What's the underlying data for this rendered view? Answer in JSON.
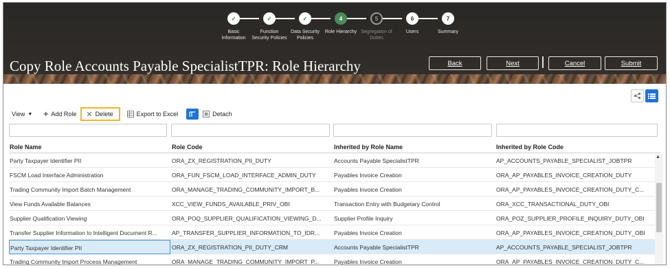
{
  "title": "Copy Role Accounts Payable SpecialistTPR: Role Hierarchy",
  "train": {
    "steps": [
      {
        "num": "✓",
        "label": "Basic\nInformation",
        "state": "done"
      },
      {
        "num": "✓",
        "label": "Function\nSecurity Policies",
        "state": "done"
      },
      {
        "num": "✓",
        "label": "Data Security\nPolicies",
        "state": "done"
      },
      {
        "num": "4",
        "label": "Role Hierarchy",
        "state": "current"
      },
      {
        "num": "5",
        "label": "Segregation of\nDuties",
        "state": "disabled"
      },
      {
        "num": "6",
        "label": "Users",
        "state": "future"
      },
      {
        "num": "7",
        "label": "Summary",
        "state": "future"
      }
    ]
  },
  "buttons": {
    "back": "Back",
    "next": "Next",
    "cancel": "Cancel",
    "submit": "Submit"
  },
  "toolbar": {
    "view": "View",
    "add_role": "Add Role",
    "delete": "Delete",
    "export": "Export to Excel",
    "detach": "Detach"
  },
  "table": {
    "columns": [
      "Role Name",
      "Role Code",
      "Inherited by Role Name",
      "Inherited by Role Code"
    ],
    "rows": [
      [
        "Party Taxpayer Identifier PII",
        "ORA_ZX_REGISTRATION_PII_DUTY",
        "Accounts Payable SpecialistTPR",
        "AP_ACCOUNTS_PAYABLE_SPECIALIST_JOBTPR"
      ],
      [
        "FSCM Load Interface Administration",
        "ORA_FUN_FSCM_LOAD_INTERFACE_ADMIN_DUTY",
        "Payables Invoice Creation",
        "ORA_AP_PAYABLES_INVOICE_CREATION_DUTY"
      ],
      [
        "Trading Community Import Batch Management",
        "ORA_MANAGE_TRADING_COMMUNITY_IMPORT_B...",
        "Payables Invoice Creation",
        "ORA_AP_PAYABLES_INVOICE_CREATION_DUTY_C..."
      ],
      [
        "View Funds Available Balances",
        "XCC_VIEW_FUNDS_AVAILABLE_PRIV_OBI",
        "Transaction Entry with Budgetary Control",
        "ORA_XCC_TRANSACTIONAL_DUTY_OBI"
      ],
      [
        "Supplier Qualification Viewing",
        "ORA_POQ_SUPPLIER_QUALIFICATION_VIEWING_D...",
        "Supplier Profile Inquiry",
        "ORA_POZ_SUPPLIER_PROFILE_INQUIRY_DUTY_OBI"
      ],
      [
        "Transfer Supplier Information to Intelligent Document R...",
        "AP_TRANSFER_SUPPLIER_INFORMATION_TO_IDR...",
        "Payables Invoice Creation",
        "ORA_AP_PAYABLES_INVOICE_CREATION_DUTY_OBI"
      ],
      [
        "Party Taxpayer Identifier PII",
        "ORA_ZX_REGISTRATION_PII_DUTY_CRM",
        "Accounts Payable SpecialistTPR",
        "AP_ACCOUNTS_PAYABLE_SPECIALIST_JOBTPR"
      ],
      [
        "Trading Community Import Process Management",
        "ORA_MANAGE_TRADING_COMMUNITY_IMPORT_P...",
        "Payables Invoice Creation",
        "ORA_AP_PAYABLES_INVOICE_CREATION_DUTY_C..."
      ]
    ],
    "selected_row": 6
  },
  "colors": {
    "accent": "#1e73d6",
    "highlight": "#f2b425",
    "selected_row": "#d9ebf8",
    "header_bg": "#2e2b28"
  }
}
